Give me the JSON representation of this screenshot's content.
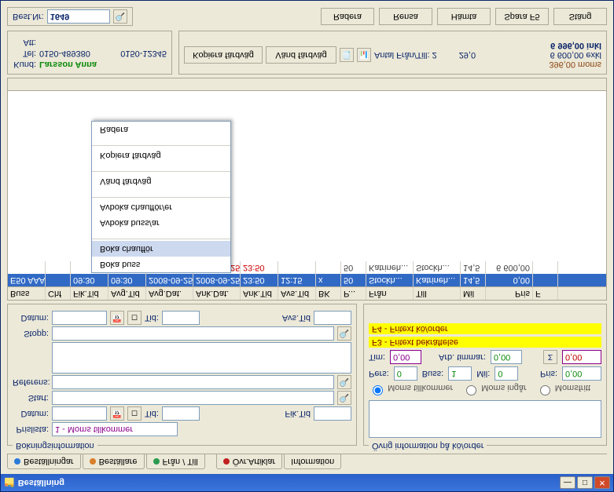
{
  "window": {
    "title": "Beställning"
  },
  "tabs": [
    {
      "label": "Beställningar",
      "dot": "#2a7ad9"
    },
    {
      "label": "Beställare",
      "dot": "#d97f2a"
    },
    {
      "label": "Från / Till",
      "dot": "#2a9a4f"
    },
    {
      "label": "Övr.Artiklar",
      "dot": "#c02020"
    },
    {
      "label": "Information",
      "dot": ""
    }
  ],
  "booking": {
    "legend": "Bokningsinformation",
    "prislista_label": "Prislista:",
    "prislista_value": "1 - Moms tillkommer",
    "datum_label": "Datum:",
    "tid_label": "Tid:",
    "fiktid_label": "Fik.Tid",
    "start_label": "Start:",
    "referens_label": "Referens:",
    "stopp_label": "Stopp:",
    "datum2_label": "Datum:",
    "tid2_label": "Tid:",
    "avstid_label": "Avs.Tid"
  },
  "other": {
    "legend": "Övrig information på kö/order",
    "hl1": "F3 - Fritext bekräftelse",
    "hl2": "F4 - Fritext kö/order",
    "pers_label": "Pers:",
    "pers_val": "0",
    "buss_label": "Buss:",
    "buss_val": "1",
    "mil_label": "Mil:",
    "mil_val": "0",
    "pris_label": "Pris:",
    "pris_val": "0,00",
    "tim_label": "Tim:",
    "tim_val": "0,00",
    "arb_label": "Arb. timmar:",
    "arb_val": "0,00",
    "right_val": "0,00",
    "radio1": "Moms tillkommer",
    "radio2": "Moms ingår",
    "radio3": "Momsfritt"
  },
  "grid": {
    "headers": [
      "Buss",
      "Chf",
      "Fik.Tid",
      "Avg.Tid",
      "Avg.Dat.",
      "Ank.Dat.",
      "Ank.Tid",
      "Avs.Tid",
      "BK",
      "P...",
      "Från",
      "Till",
      "Mil",
      "Pris",
      "F"
    ],
    "row": [
      "E50 AAA",
      "",
      "09:30",
      "09:30",
      "2008-09-25",
      "2008-09-25",
      "23:50",
      "12:15",
      "x",
      "50",
      "Stockh...",
      "Katrineh...",
      "14,5",
      "0,00",
      ""
    ],
    "mid_date": "2008-09-25",
    "mid_bk": "50",
    "mid_from": "Katrineh...",
    "mid_to": "Stockh...",
    "mid_mil": "14,5",
    "mid_pris": "6 600,00"
  },
  "context": {
    "items": [
      "Boka buss",
      "Boka chaufför",
      "Avboka buss/ar",
      "Avboka chaufför/er",
      "Vänd färdväg",
      "Kopiera färdväg",
      "Radera"
    ],
    "highlight": 1
  },
  "footer": {
    "btn_kopiera": "Kopiera färdväg",
    "btn_vand": "Vänd färdväg",
    "antal_label": "Antal Från/Till: 2",
    "mil_sum": "29,0",
    "moms": "396,00 moms",
    "exkl": "6 600,00 exkl",
    "inkl": "6 996,00 inkl",
    "kund_label": "Kund:",
    "kund_val": "Larsson Anna",
    "tel_label": "Tel:",
    "tel_val": "0150-489380",
    "tel2_val": "0150-12345",
    "att_label": "Att:"
  },
  "topbar": {
    "best_label": "Best.Nr:",
    "best_val": "1649",
    "btn_radera": "Radera",
    "btn_rensa": "Rensa",
    "btn_hamta": "Hämta",
    "btn_spara": "Spara F5",
    "btn_stang": "Stäng"
  }
}
